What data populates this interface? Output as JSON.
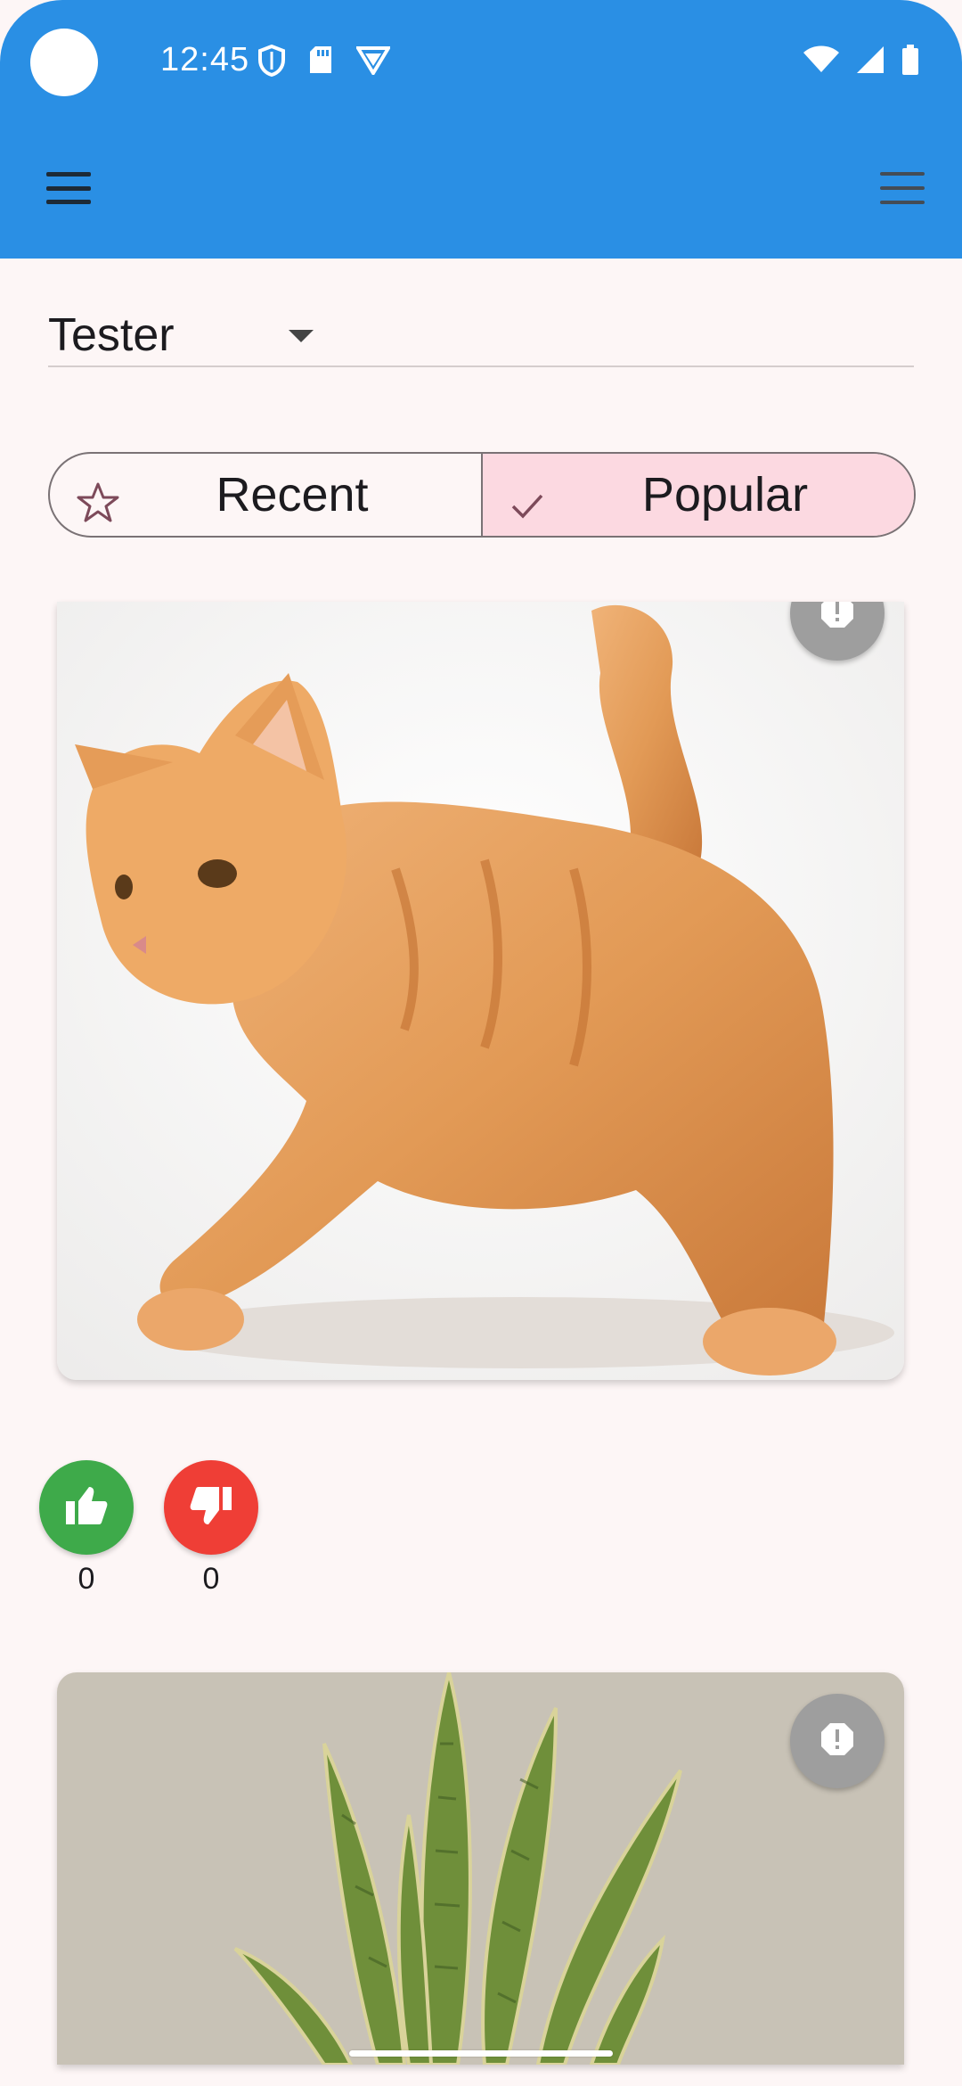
{
  "status_bar": {
    "time": "12:45",
    "left_icons": [
      "shield-icon",
      "sd-card-icon",
      "vpn-icon"
    ],
    "right_icons": [
      "wifi-icon",
      "signal-icon",
      "battery-icon"
    ]
  },
  "app_bar": {
    "menu_icon": "hamburger-menu-icon",
    "more_icon": "more-menu-icon",
    "color": "#2a8fe4"
  },
  "user_select": {
    "value": "Tester"
  },
  "sort_tabs": [
    {
      "label": "Recent",
      "icon": "star-outline-icon",
      "selected": false
    },
    {
      "label": "Popular",
      "icon": "check-icon",
      "selected": true
    }
  ],
  "posts": [
    {
      "image": "orange-cat-photo",
      "likes": "0",
      "dislikes": "0"
    },
    {
      "image": "snake-plant-photo"
    }
  ],
  "colors": {
    "like": "#3eaa4a",
    "dislike": "#ef3e36",
    "selected_segment": "#fcd9e1",
    "background": "#fdf6f6"
  }
}
